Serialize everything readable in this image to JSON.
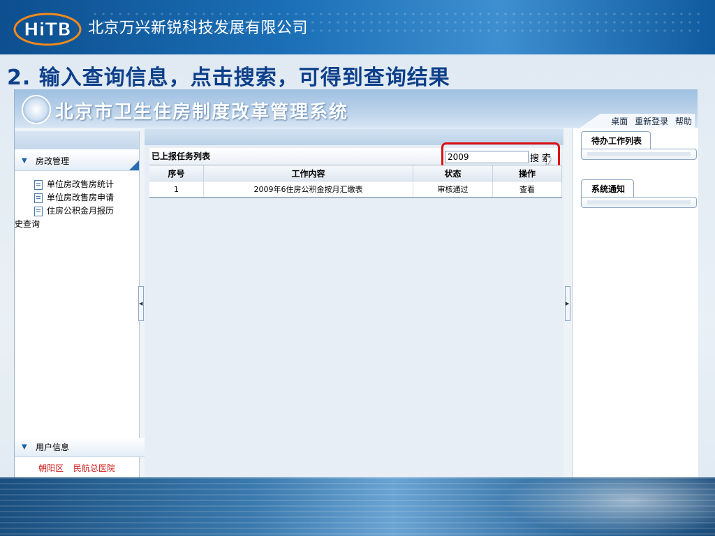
{
  "banner": {
    "logo_text": "HiTB",
    "company": "北京万兴新锐科技发展有限公司"
  },
  "slide": {
    "title": "2. 输入查询信息，点击搜索，可得到查询结果"
  },
  "app": {
    "system_title": "北京市卫生住房制度改革管理系统",
    "top_links": [
      "桌面",
      "重新登录",
      "帮助"
    ]
  },
  "sidebar": {
    "section1": "房改管理",
    "items": [
      "单位房改售房统计",
      "单位房改售房申请",
      "住房公积金月报历",
      "史查询"
    ],
    "section2": "用户信息",
    "org": [
      "朝阳区",
      "民航总医院"
    ]
  },
  "list": {
    "title": "已上报任务列表",
    "search_value": "2009",
    "search_button": "搜索",
    "columns": [
      "序号",
      "工作内容",
      "状态",
      "操作"
    ],
    "rows": [
      {
        "no": "1",
        "content": "2009年6住房公积金按月汇缴表",
        "status": "审核通过",
        "action": "查看"
      }
    ]
  },
  "right": {
    "tab1": "待办工作列表",
    "tab2": "系统通知"
  },
  "colors": {
    "highlight": "#e01010",
    "title_blue": "#0d3f8a",
    "org_red": "#cc2222"
  }
}
